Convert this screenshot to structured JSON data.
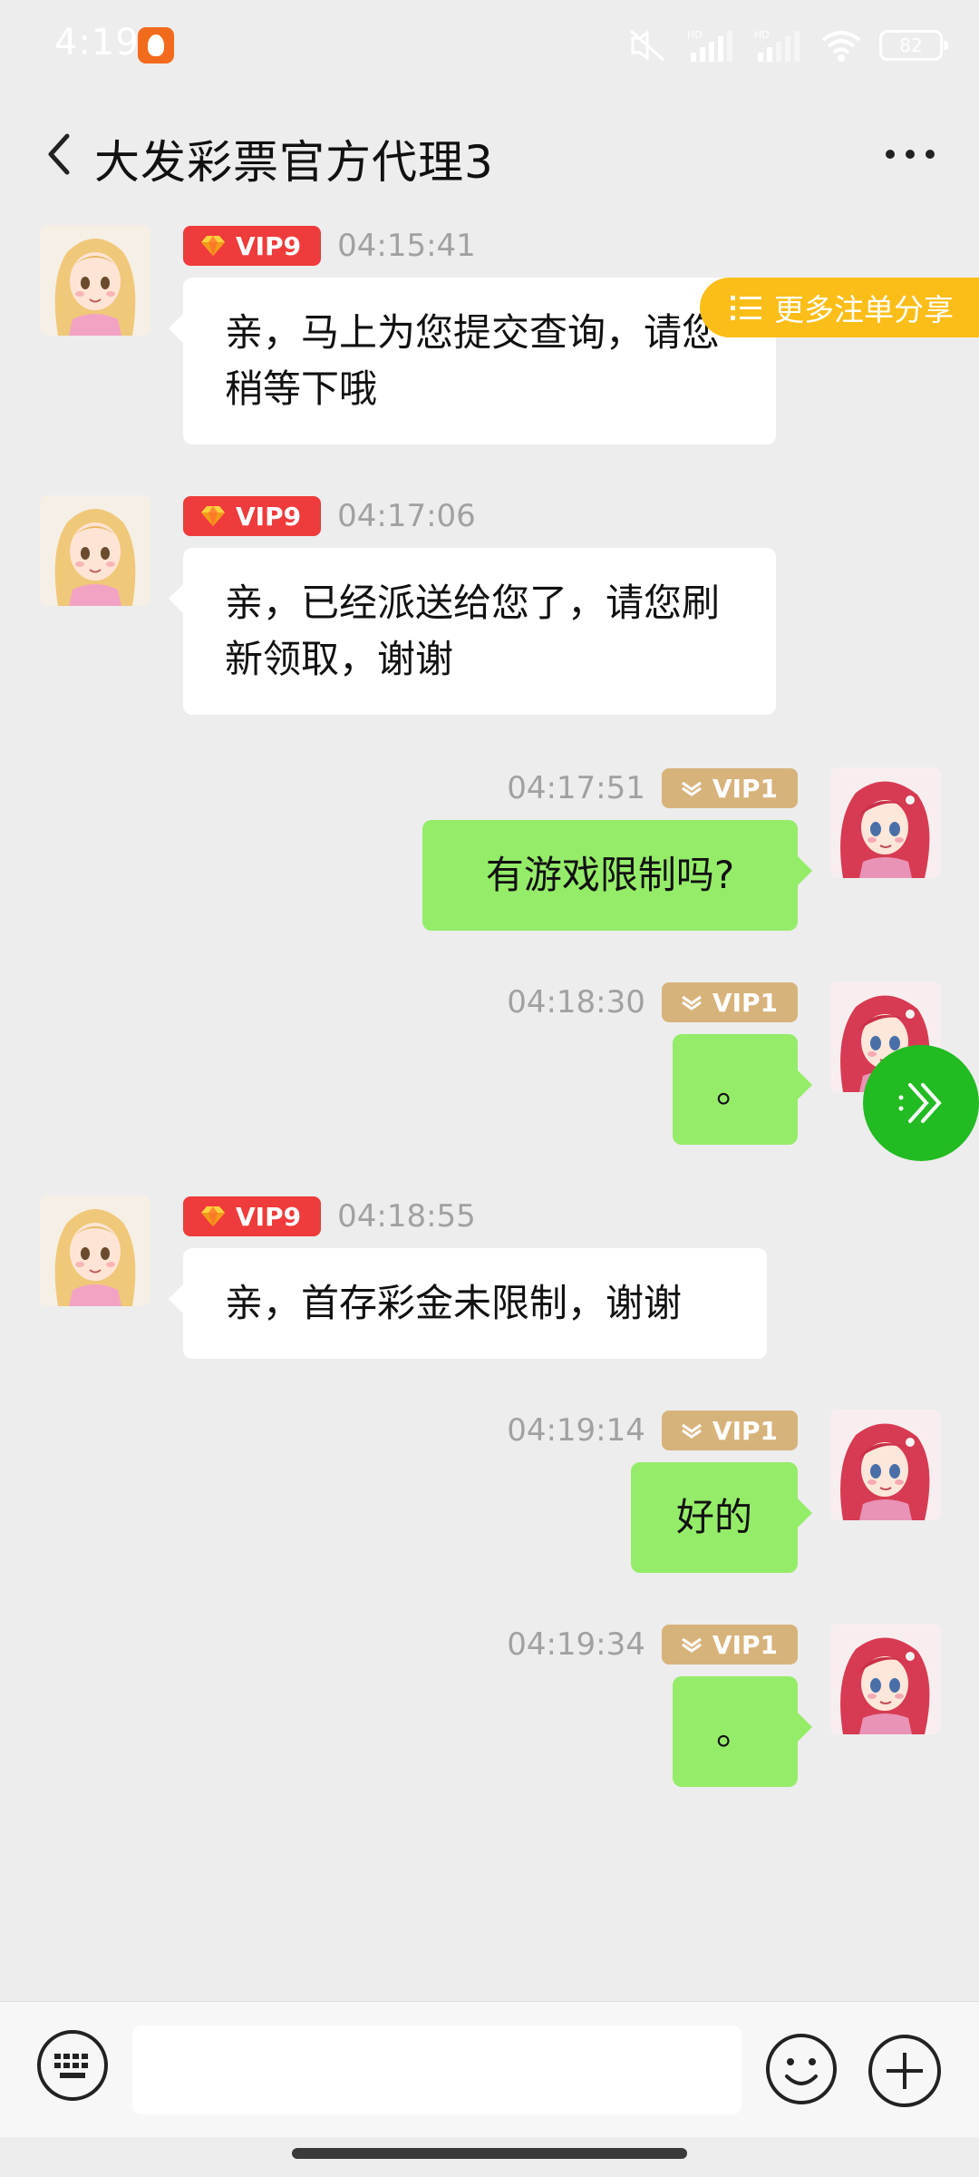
{
  "status_bar": {
    "time": "4:19",
    "battery": "82",
    "icons": [
      "mute-icon",
      "signal-hd-icon",
      "signal-hd-icon",
      "wifi-icon",
      "battery-icon"
    ]
  },
  "header": {
    "title": "大发彩票官方代理3",
    "back_icon": "chevron-left-icon",
    "more_icon": "more-dots-icon"
  },
  "floating": {
    "share_label": "更多注单分享",
    "share_icon": "list-icon",
    "fab_icon": "double-chevron-icon"
  },
  "messages": [
    {
      "side": "left",
      "badge": "VIP9",
      "time": "04:15:41",
      "text": "亲，马上为您提交查询，请您稍等下哦"
    },
    {
      "side": "left",
      "badge": "VIP9",
      "time": "04:17:06",
      "text": "亲，已经派送给您了，请您刷新领取，谢谢"
    },
    {
      "side": "right",
      "badge": "VIP1",
      "time": "04:17:51",
      "text": "有游戏限制吗?"
    },
    {
      "side": "right",
      "badge": "VIP1",
      "time": "04:18:30",
      "text": "。"
    },
    {
      "side": "left",
      "badge": "VIP9",
      "time": "04:18:55",
      "text": "亲，首存彩金未限制，谢谢"
    },
    {
      "side": "right",
      "badge": "VIP1",
      "time": "04:19:14",
      "text": "好的"
    },
    {
      "side": "right",
      "badge": "VIP1",
      "time": "04:19:34",
      "text": "。"
    }
  ],
  "input": {
    "value": "",
    "keyboard_icon": "keyboard-icon",
    "emoji_icon": "emoji-icon",
    "plus_icon": "plus-circle-icon"
  },
  "colors": {
    "background": "#ededed",
    "bubble_self": "#95ec69",
    "bubble_other": "#ffffff",
    "vip9_badge": "#ef3b3b",
    "vip1_badge": "#d7b37c",
    "share_pill": "#fbbe19",
    "fab": "#22bb22"
  }
}
